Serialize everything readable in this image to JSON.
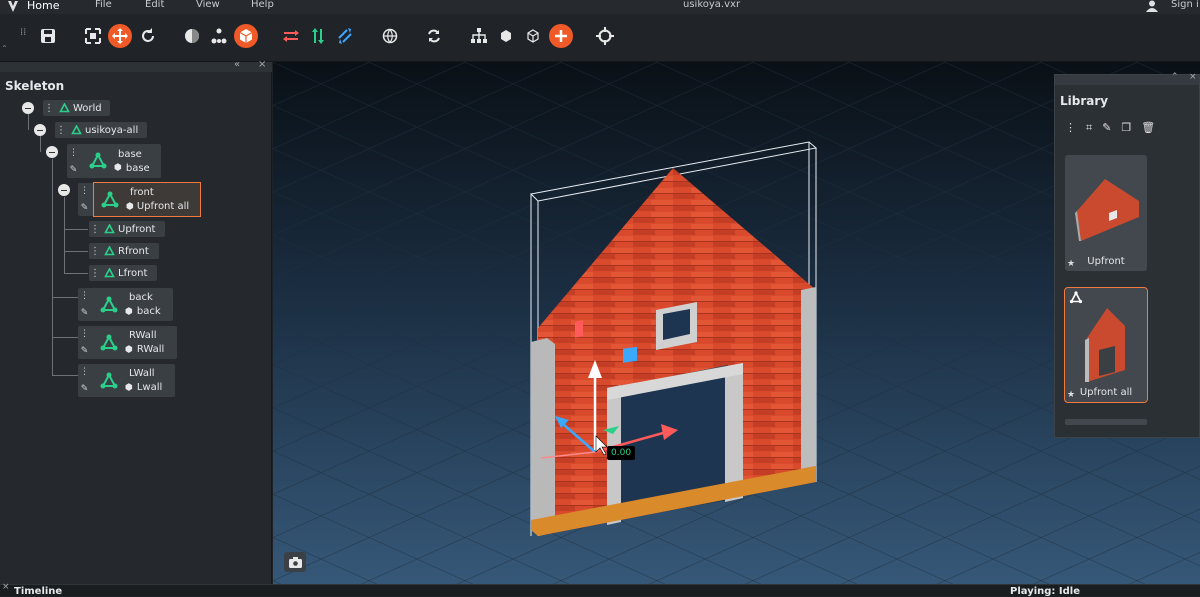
{
  "menubar": {
    "home": "Home",
    "file": "File",
    "edit": "Edit",
    "view": "View",
    "help": "Help",
    "title": "usikoya.vxr",
    "signin": "Sign i"
  },
  "skeleton": {
    "title": "Skeleton",
    "nodes": {
      "world": "World",
      "usikoya": "usikoya-all",
      "base": "base",
      "base_model": "base",
      "front": "front",
      "front_model": "Upfront all",
      "upfront": "Upfront",
      "rfront": "Rfront",
      "lfront": "Lfront",
      "back": "back",
      "back_model": "back",
      "rwall": "RWall",
      "rwall_model": "RWall",
      "lwall": "LWall",
      "lwall_model": "Lwall"
    }
  },
  "viewport": {
    "readout": "0.00"
  },
  "library": {
    "title": "Library",
    "items": [
      "Upfront",
      "Upfront all"
    ]
  },
  "bottom": {
    "timeline": "Timeline",
    "playing": "Playing: Idle"
  },
  "colors": {
    "accent": "#f05a28",
    "node_green": "#2ad08a"
  }
}
